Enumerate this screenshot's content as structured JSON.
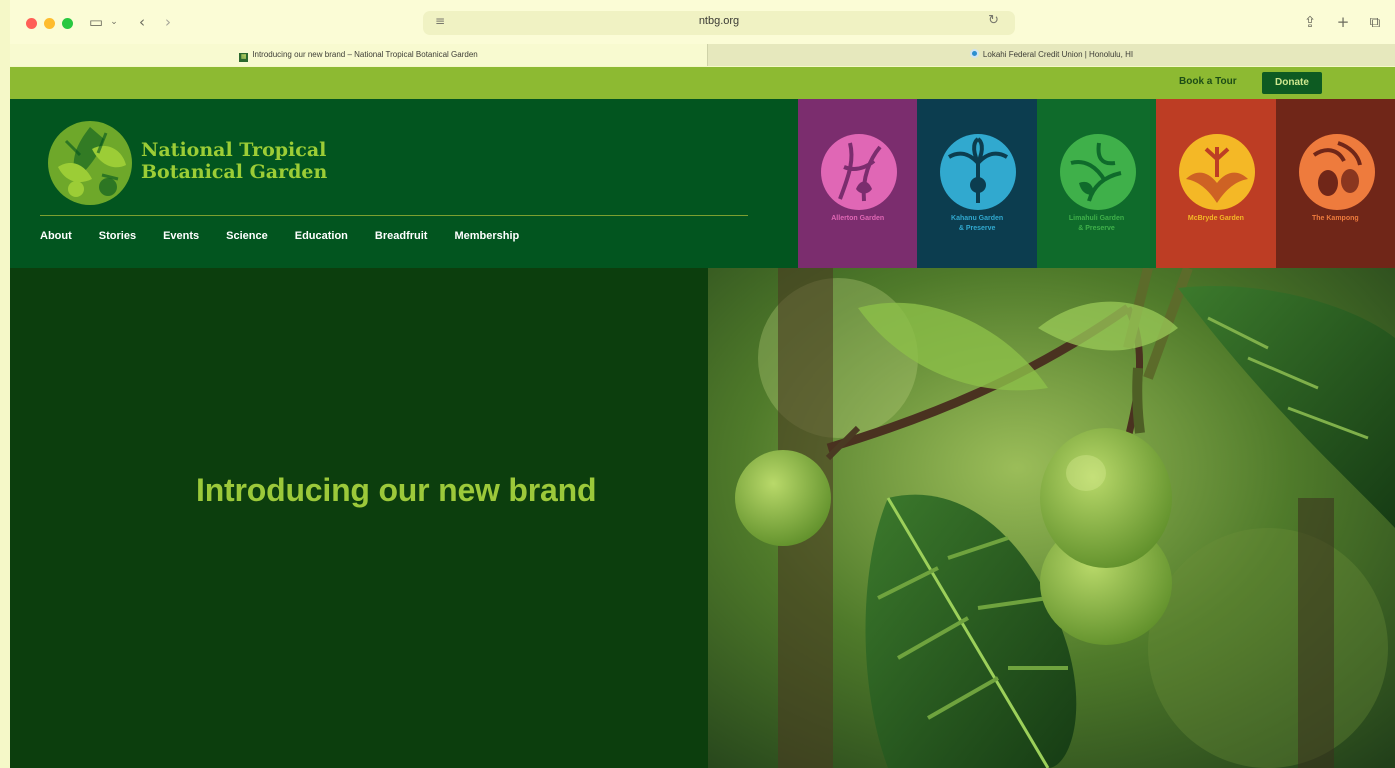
{
  "browser": {
    "url": "ntbg.org",
    "tabs": [
      {
        "label": "Introducing our new brand – National Tropical Botanical Garden",
        "favicon": "ntbg-favicon"
      },
      {
        "label": "Lokahi Federal Credit Union | Honolulu, HI",
        "favicon": "lokahi-favicon"
      }
    ]
  },
  "site": {
    "utility": {
      "book_tour": "Book a Tour",
      "donate": "Donate"
    },
    "logo": {
      "line1": "National Tropical",
      "line2": "Botanical Garden"
    },
    "nav": [
      "About",
      "Stories",
      "Events",
      "Science",
      "Education",
      "Breadfruit",
      "Membership"
    ],
    "gardens": [
      {
        "name": "Allerton Garden",
        "line2": "",
        "bg": "#7b2d6e",
        "fg": "#e067b5"
      },
      {
        "name": "Kahanu Garden",
        "line2": "& Preserve",
        "bg": "#0c3d4f",
        "fg": "#31a9cf"
      },
      {
        "name": "Limahuli Garden",
        "line2": "& Preserve",
        "bg": "#0f6b2b",
        "fg": "#3fb04a"
      },
      {
        "name": "McBryde Garden",
        "line2": "",
        "bg": "#bd3d24",
        "fg": "#f4b826"
      },
      {
        "name": "The Kampong",
        "line2": "",
        "bg": "#702618",
        "fg": "#ee7b3d"
      }
    ],
    "hero": {
      "title": "Introducing our new brand"
    }
  },
  "colors": {
    "utility_bar": "#8dba32",
    "header": "#02551f",
    "hero_bg": "#0c3e0d",
    "accent": "#9cc93a"
  }
}
